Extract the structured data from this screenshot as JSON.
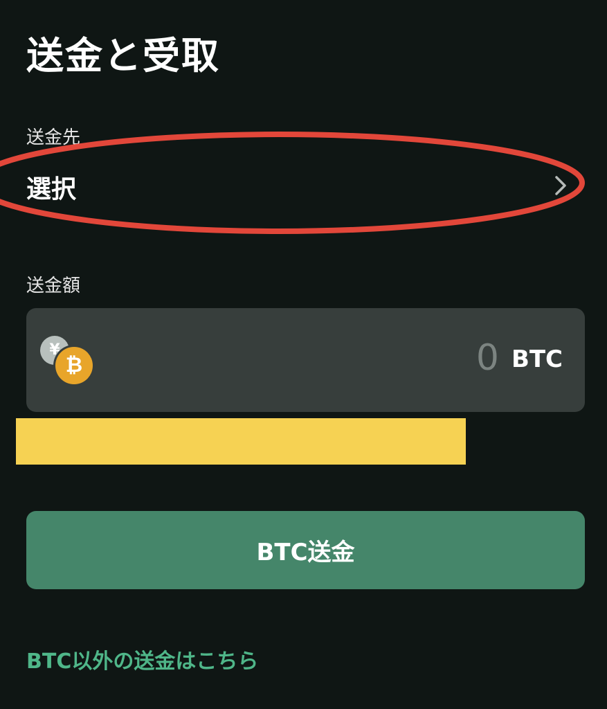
{
  "header": {
    "title": "送金と受取"
  },
  "destination": {
    "label": "送金先",
    "select_text": "選択",
    "chevron_icon": "chevron-right-icon"
  },
  "amount": {
    "label": "送金額",
    "value": "0",
    "unit": "BTC",
    "yen_symbol": "¥",
    "btc_symbol": "₿"
  },
  "actions": {
    "send_label": "BTC送金",
    "other_link": "BTC以外の送金はこちら"
  },
  "colors": {
    "background": "#0f1614",
    "input_box": "#373e3c",
    "button": "#45866a",
    "link": "#4fb689",
    "highlight_ring": "#e2473a",
    "redaction": "#f6d253",
    "btc_coin": "#e8a52a"
  }
}
